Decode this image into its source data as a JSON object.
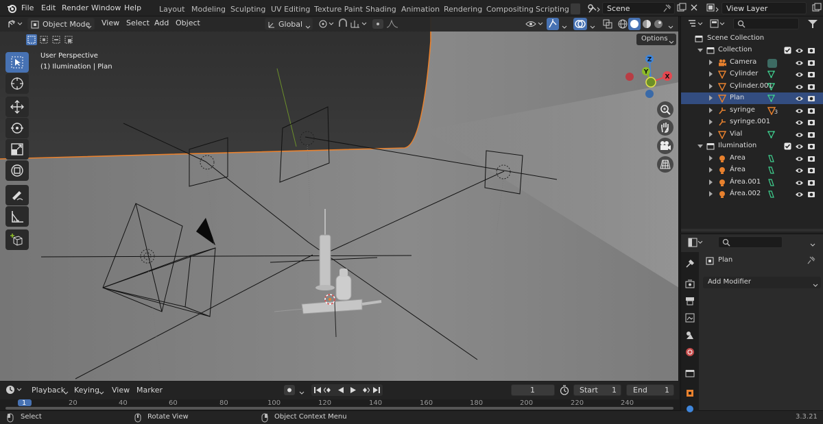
{
  "menu": {
    "items": [
      "File",
      "Edit",
      "Render",
      "Window",
      "Help"
    ],
    "workspaces": [
      "Layout",
      "Modeling",
      "Sculpting",
      "UV Editing",
      "Texture Paint",
      "Shading",
      "Animation",
      "Rendering",
      "Compositing",
      "Scripting"
    ],
    "scene_value": "Scene",
    "view_layer_value": "View Layer"
  },
  "viewport": {
    "mode": "Object Mode",
    "menus": [
      "View",
      "Select",
      "Add",
      "Object"
    ],
    "orientation": "Global",
    "overlay_title": "User Perspective",
    "overlay_subtitle": "(1) Ilumination | Plan",
    "options_label": "Options",
    "gizmo_axes": [
      "X",
      "Y",
      "Z"
    ]
  },
  "outliner": {
    "root": "Scene Collection",
    "rows": [
      {
        "label": "Collection",
        "type": "collection",
        "expanded": true,
        "indent": 1
      },
      {
        "label": "Camera",
        "type": "camera",
        "indent": 2
      },
      {
        "label": "Cylinder",
        "type": "mesh",
        "indent": 2
      },
      {
        "label": "Cylinder.001",
        "type": "mesh",
        "indent": 2
      },
      {
        "label": "Plan",
        "type": "mesh",
        "indent": 2,
        "selected": true
      },
      {
        "label": "syringe",
        "type": "armature",
        "indent": 2,
        "badge": "3"
      },
      {
        "label": "syringe.001",
        "type": "armature",
        "indent": 2
      },
      {
        "label": "Vial",
        "type": "mesh",
        "indent": 2
      },
      {
        "label": "Ilumination",
        "type": "collection",
        "expanded": true,
        "indent": 1
      },
      {
        "label": "Area",
        "type": "light",
        "indent": 2
      },
      {
        "label": "Área",
        "type": "light",
        "indent": 2
      },
      {
        "label": "Área.001",
        "type": "light",
        "indent": 2
      },
      {
        "label": "Área.002",
        "type": "light",
        "indent": 2
      }
    ]
  },
  "properties": {
    "object_name": "Plan",
    "add_modifier": "Add Modifier"
  },
  "timeline": {
    "menus": [
      "Playback",
      "Keying",
      "View",
      "Marker"
    ],
    "current_frame": "1",
    "start_label": "Start",
    "start_value": "1",
    "end_label": "End",
    "end_value": "1",
    "ruler": [
      "1",
      "20",
      "40",
      "60",
      "80",
      "100",
      "120",
      "140",
      "160",
      "180",
      "200",
      "220",
      "240"
    ]
  },
  "status": {
    "select": "Select",
    "rotate": "Rotate View",
    "context": "Object Context Menu",
    "version": "3.3.21"
  },
  "colors": {
    "accent": "#4772b3",
    "selection_outline": "#e8812e",
    "x_axis": "#e5474f",
    "y_axis": "#8cbb28",
    "z_axis": "#3f86db"
  }
}
